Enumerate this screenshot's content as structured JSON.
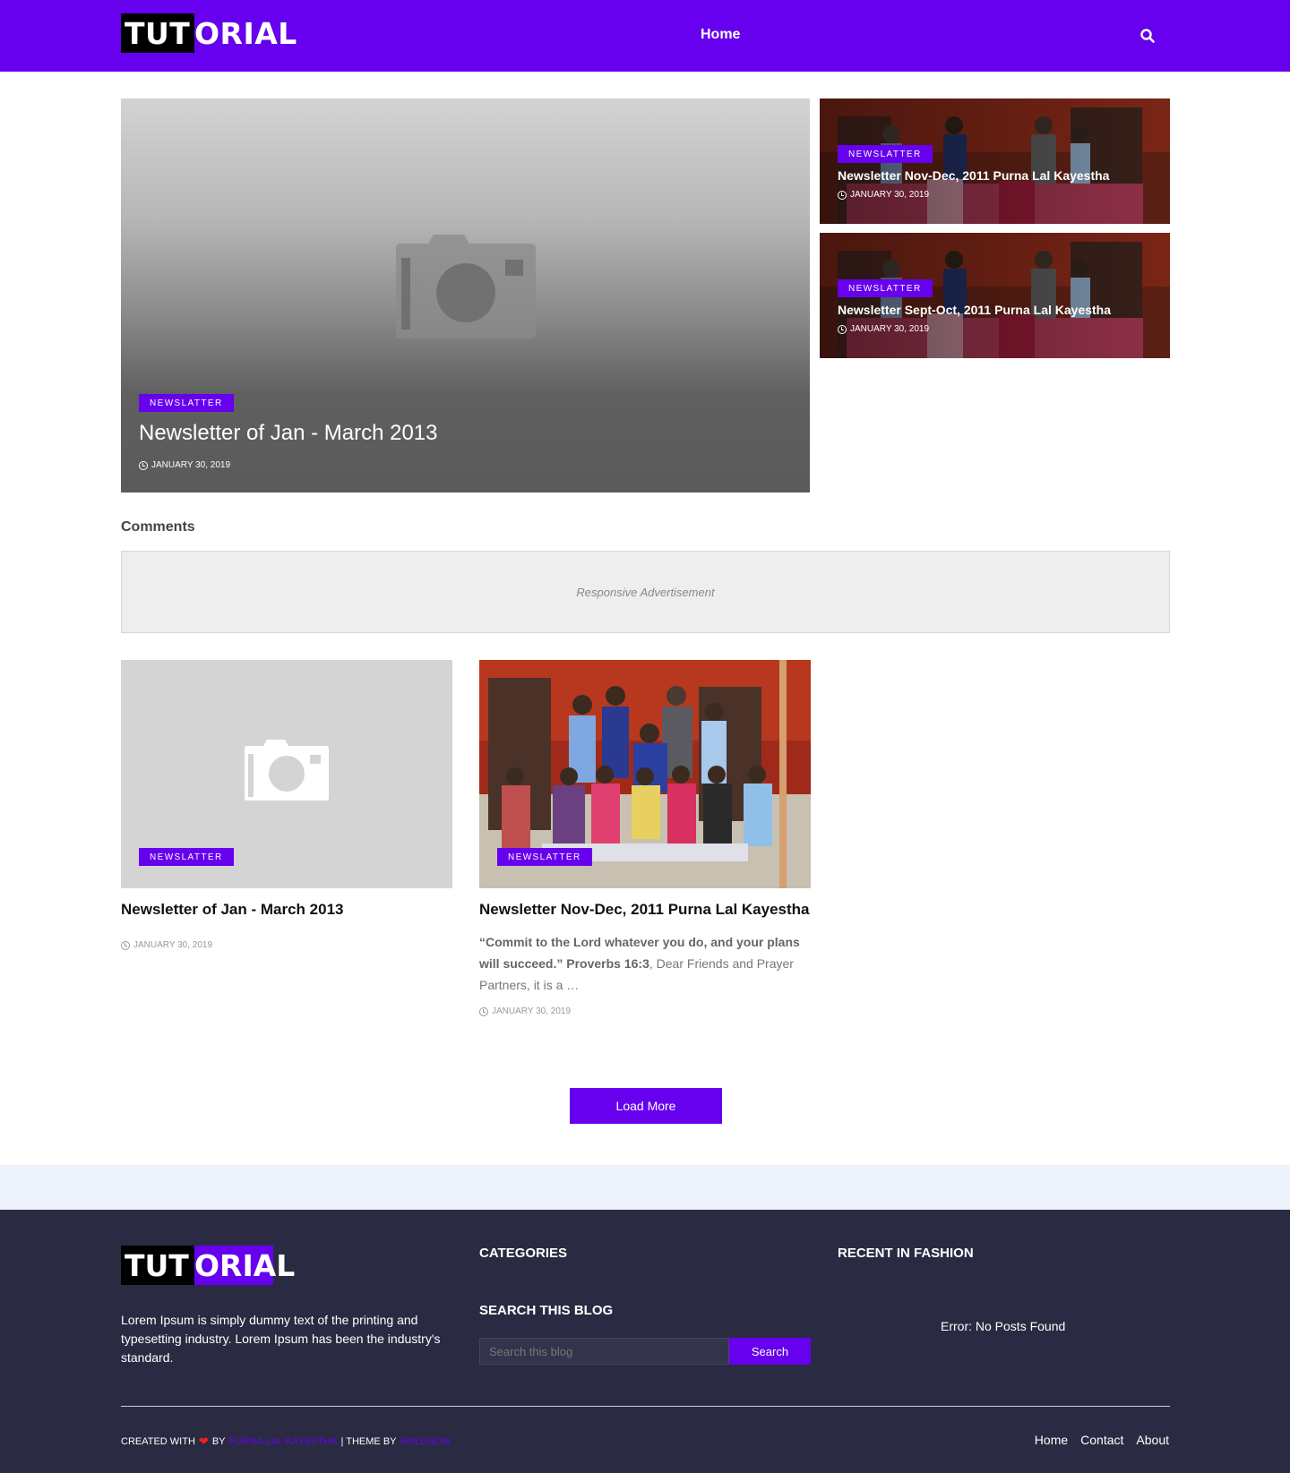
{
  "header": {
    "logo_part1": "TUT",
    "logo_part2": "ORIAL",
    "nav_home": "Home"
  },
  "featured": {
    "label": "NEWSLATTER",
    "title": "Newsletter of Jan - March 2013",
    "date": "JANUARY 30, 2019"
  },
  "side_posts": [
    {
      "label": "NEWSLATTER",
      "title": "Newsletter Nov-Dec, 2011 Purna Lal Kayestha",
      "date": "JANUARY 30, 2019"
    },
    {
      "label": "NEWSLATTER",
      "title": "Newsletter Sept-Oct, 2011 Purna Lal Kayestha",
      "date": "JANUARY 30, 2019"
    }
  ],
  "comments_title": "Comments",
  "ad_text": "Responsive Advertisement",
  "posts": [
    {
      "label": "NEWSLATTER",
      "title": "Newsletter of Jan - March 2013",
      "date": "JANUARY 30, 2019"
    },
    {
      "label": "NEWSLATTER",
      "title": "Newsletter Nov-Dec, 2011 Purna Lal Kayestha",
      "snippet_bold": "“Commit to the Lord whatever you do, and your plans will succeed.” Proverbs 16:3",
      "snippet_rest": ", Dear Friends and Prayer Partners, it is a …",
      "date": "JANUARY 30, 2019"
    }
  ],
  "load_more": "Load More",
  "footer": {
    "logo_part1": "TUT",
    "logo_part2": "ORIAL",
    "description": "Lorem Ipsum is simply dummy text of the printing and typesetting industry. Lorem Ipsum has been the industry's standard.",
    "categories_title": "CATEGORIES",
    "search_title": "SEARCH THIS BLOG",
    "search_placeholder": "Search this blog",
    "search_button": "Search",
    "recent_title": "RECENT IN FASHION",
    "recent_error": "Error: No Posts Found",
    "credit_created": "CREATED WITH",
    "credit_by": "BY",
    "credit_author": "PURNA LAL KAYESTHA",
    "credit_theme": "| THEME BY",
    "credit_theme_author": "HOLENOW",
    "links": [
      "Home",
      "Contact",
      "About"
    ]
  },
  "colors": {
    "accent": "#6600ee",
    "footer_bg": "#2a2b42",
    "heart": "#ff1a1a"
  },
  "icons": {
    "search": "search-icon",
    "clock": "clock-icon",
    "camera": "camera-placeholder-icon",
    "heart": "heart-icon"
  }
}
